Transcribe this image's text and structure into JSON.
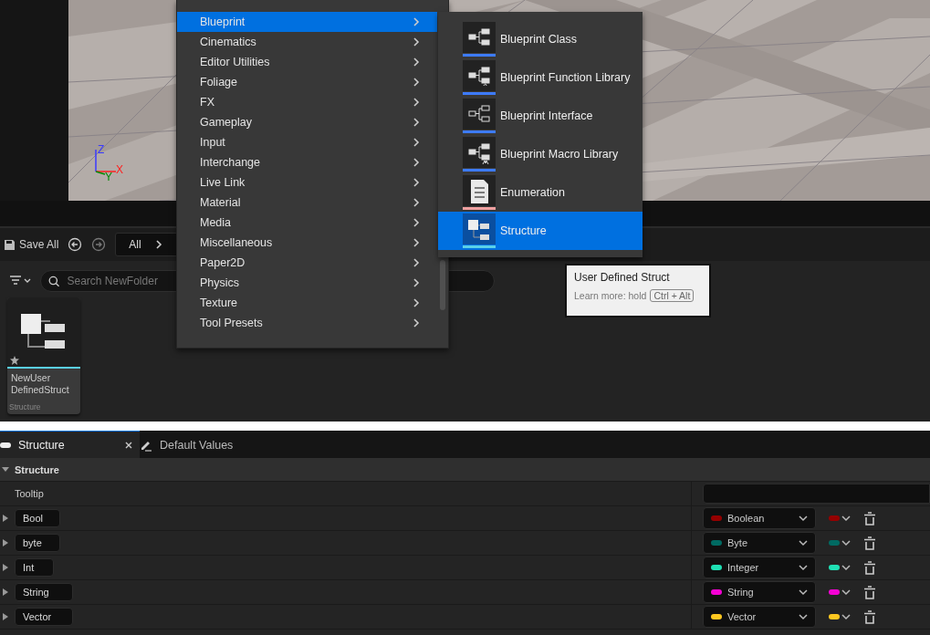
{
  "viewport": {
    "axes": [
      {
        "label": "Z",
        "color": "#3a3aff"
      },
      {
        "label": "X",
        "color": "#ff2020"
      },
      {
        "label": "Y",
        "color": "#008a00"
      }
    ]
  },
  "toolbar": {
    "save_all": "Save All",
    "breadcrumb": "All"
  },
  "search": {
    "placeholder": "Search NewFolder"
  },
  "assets": [
    {
      "name_lines": [
        "NewUser",
        "DefinedStruct"
      ],
      "type": "Structure",
      "modified": true
    }
  ],
  "menu": {
    "items": [
      {
        "label": "Blueprint",
        "selected": true
      },
      {
        "label": "Cinematics",
        "selected": false
      },
      {
        "label": "Editor Utilities",
        "selected": false
      },
      {
        "label": "Foliage",
        "selected": false
      },
      {
        "label": "FX",
        "selected": false
      },
      {
        "label": "Gameplay",
        "selected": false
      },
      {
        "label": "Input",
        "selected": false
      },
      {
        "label": "Interchange",
        "selected": false
      },
      {
        "label": "Live Link",
        "selected": false
      },
      {
        "label": "Material",
        "selected": false
      },
      {
        "label": "Media",
        "selected": false
      },
      {
        "label": "Miscellaneous",
        "selected": false
      },
      {
        "label": "Paper2D",
        "selected": false
      },
      {
        "label": "Physics",
        "selected": false
      },
      {
        "label": "Texture",
        "selected": false
      },
      {
        "label": "Tool Presets",
        "selected": false
      }
    ]
  },
  "submenu": {
    "items": [
      {
        "label": "Blueprint Class",
        "kind": "graph",
        "color": "#3d7bff",
        "selected": false
      },
      {
        "label": "Blueprint Function Library",
        "kind": "function",
        "color": "#3d7bff",
        "selected": false
      },
      {
        "label": "Blueprint Interface",
        "kind": "interface",
        "color": "#3d7bff",
        "selected": false
      },
      {
        "label": "Blueprint Macro Library",
        "kind": "macro",
        "color": "#3d7bff",
        "selected": false
      },
      {
        "label": "Enumeration",
        "kind": "enum",
        "color": "#f0a0a0",
        "selected": false
      },
      {
        "label": "Structure",
        "kind": "struct",
        "color": "#5ad0e8",
        "selected": true
      }
    ]
  },
  "tooltip": {
    "title": "User Defined Struct",
    "hint": "Learn more: hold",
    "key": "Ctrl + Alt"
  },
  "panel": {
    "tabs": [
      {
        "label": "Structure",
        "kind": "struct",
        "selected": true
      },
      {
        "label": "Default Values",
        "kind": "edit",
        "selected": false
      }
    ],
    "section": {
      "title": "Structure",
      "expanded": true
    },
    "tooltip_label": "Tooltip",
    "members": [
      {
        "name": "Bool",
        "type": "Boolean",
        "color": "#950000",
        "expanded": false
      },
      {
        "name": "byte",
        "type": "Byte",
        "color": "#006a62",
        "expanded": false
      },
      {
        "name": "Int",
        "type": "Integer",
        "color": "#1fe0b4",
        "expanded": false
      },
      {
        "name": "String",
        "type": "String",
        "color": "#f500d4",
        "expanded": false
      },
      {
        "name": "Vector",
        "type": "Vector",
        "color": "#ffc820",
        "expanded": false
      }
    ]
  }
}
